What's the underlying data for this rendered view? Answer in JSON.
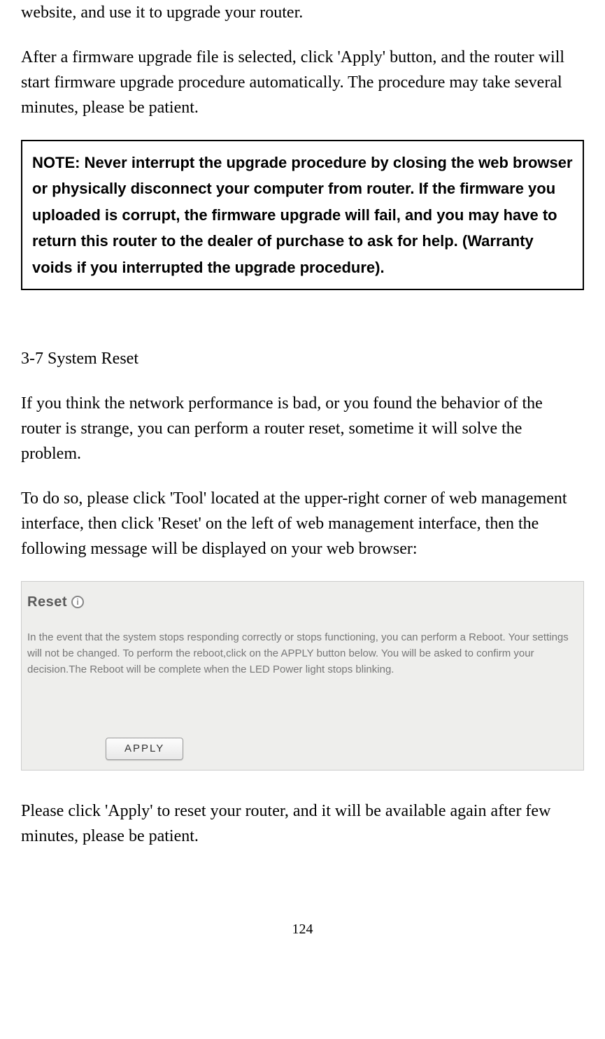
{
  "intro": {
    "line1": "website, and use it to upgrade your router.",
    "para2": "After a firmware upgrade file is selected, click 'Apply' button, and the router will start firmware upgrade procedure automatically. The procedure may take several minutes, please be patient."
  },
  "note": {
    "text": "NOTE: Never interrupt the upgrade procedure by closing the web browser or physically disconnect your computer from router. If the firmware you uploaded is corrupt, the firmware upgrade will fail, and you may have to return this router to the dealer of purchase to ask for help. (Warranty voids if you interrupted the upgrade procedure)."
  },
  "section": {
    "heading": "3-7 System Reset",
    "para1": "If you think the network performance is bad, or you found the behavior of the router is strange, you can perform a router reset, sometime it will solve the problem.",
    "para2": "To do so, please click 'Tool' located at the upper-right corner of web management interface, then click 'Reset' on the left of web management interface, then the following message will be displayed on your web browser:"
  },
  "panel": {
    "title": "Reset",
    "info_glyph": "i",
    "body": "In the event that the system stops responding correctly or stops functioning, you can perform a Reboot. Your settings will not be changed. To perform the reboot,click on the APPLY button below. You will be asked to confirm your decision.The Reboot will be complete when the LED Power light stops blinking.",
    "apply_label": "APPLY"
  },
  "closing": {
    "text": "Please click 'Apply' to reset your router, and it will be available again after few minutes, please be patient."
  },
  "page_number": "124"
}
